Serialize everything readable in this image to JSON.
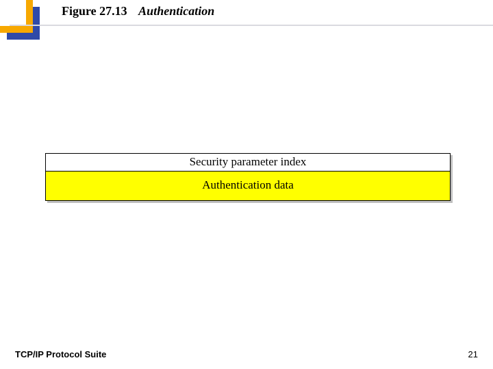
{
  "caption": {
    "label": "Figure 27.13",
    "title": "Authentication"
  },
  "packet": {
    "rows": {
      "spi": "Security parameter index",
      "auth": "Authentication data"
    }
  },
  "footer": {
    "left": "TCP/IP Protocol Suite",
    "page": "21"
  }
}
